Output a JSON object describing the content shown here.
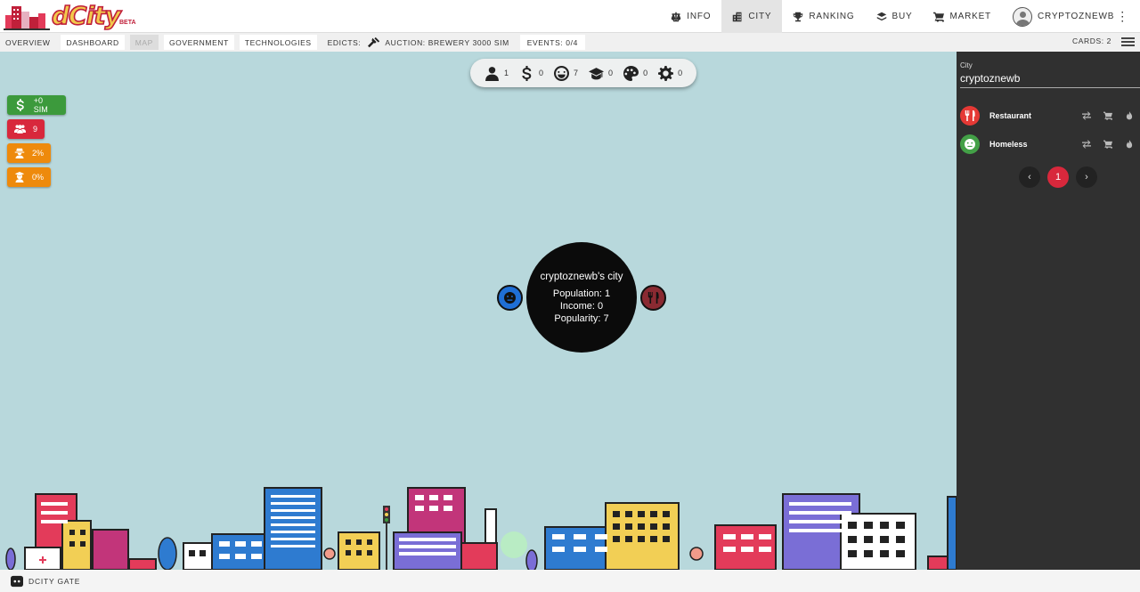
{
  "app": {
    "logo_text": "dCity",
    "logo_badge": "BETA"
  },
  "nav": {
    "items": [
      {
        "label": "INFO",
        "icon": "scales-icon"
      },
      {
        "label": "CITY",
        "icon": "city-icon",
        "active": true
      },
      {
        "label": "RANKING",
        "icon": "trophy-icon"
      },
      {
        "label": "BUY",
        "icon": "layers-icon"
      },
      {
        "label": "MARKET",
        "icon": "cart-icon"
      }
    ],
    "user": "CRYPTOZNEWB"
  },
  "subnav": {
    "overview": "OVERVIEW",
    "dashboard": "DASHBOARD",
    "map": "MAP",
    "government": "GOVERNMENT",
    "technologies": "TECHNOLOGIES",
    "edicts": "EDICTS:",
    "auction": "AUCTION: BREWERY 3000 SIM",
    "events": "EVENTS: 0/4",
    "cards": "CARDS: 2"
  },
  "stats": {
    "population": "1",
    "income": "0",
    "happiness": "7",
    "education": "0",
    "culture": "0",
    "technology": "0"
  },
  "badges": {
    "income": "+0 SIM",
    "workers": "9",
    "unemployment": "2%",
    "education": "0%"
  },
  "city": {
    "name": "cryptoznewb's city",
    "population": "Population: 1",
    "income": "Income: 0",
    "popularity": "Popularity: 7"
  },
  "panel": {
    "label": "City",
    "value": "cryptoznewb",
    "cards": [
      {
        "name": "Restaurant",
        "color": "#e53935",
        "icon": "utensils-icon"
      },
      {
        "name": "Homeless",
        "color": "#43a047",
        "icon": "face-icon"
      }
    ],
    "page": "1",
    "prev": "‹",
    "next": "›"
  },
  "footer": {
    "label": "DCITY GATE"
  },
  "colors": {
    "map_bg": "#b8d8dc",
    "panel_bg": "#303030",
    "accent_red": "#d8283c"
  }
}
